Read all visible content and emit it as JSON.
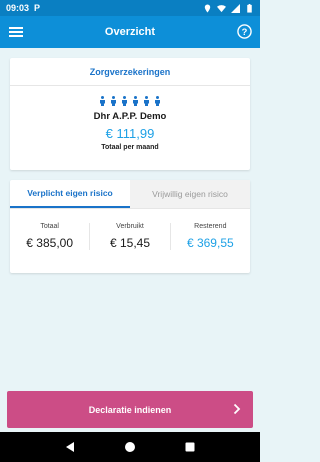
{
  "status_bar": {
    "time": "09:03",
    "notification": "P"
  },
  "app_bar": {
    "title": "Overzicht"
  },
  "insurance_card": {
    "header": "Zorgverzekeringen",
    "person_count": 6,
    "name": "Dhr A.P.P. Demo",
    "amount": "€ 111,99",
    "amount_label": "Totaal per maand"
  },
  "risk_card": {
    "tabs": [
      {
        "label": "Verplicht eigen risico",
        "active": true
      },
      {
        "label": "Vrijwillig eigen risico",
        "active": false
      }
    ],
    "stats": [
      {
        "label": "Totaal",
        "value": "€ 385,00"
      },
      {
        "label": "Verbruikt",
        "value": "€ 15,45"
      },
      {
        "label": "Resterend",
        "value": "€ 369,55"
      }
    ]
  },
  "action_button": {
    "label": "Declaratie indienen"
  },
  "colors": {
    "primary": "#0d8fd8",
    "accent_pink": "#cc4d86",
    "amount_blue": "#1ea1e6"
  }
}
